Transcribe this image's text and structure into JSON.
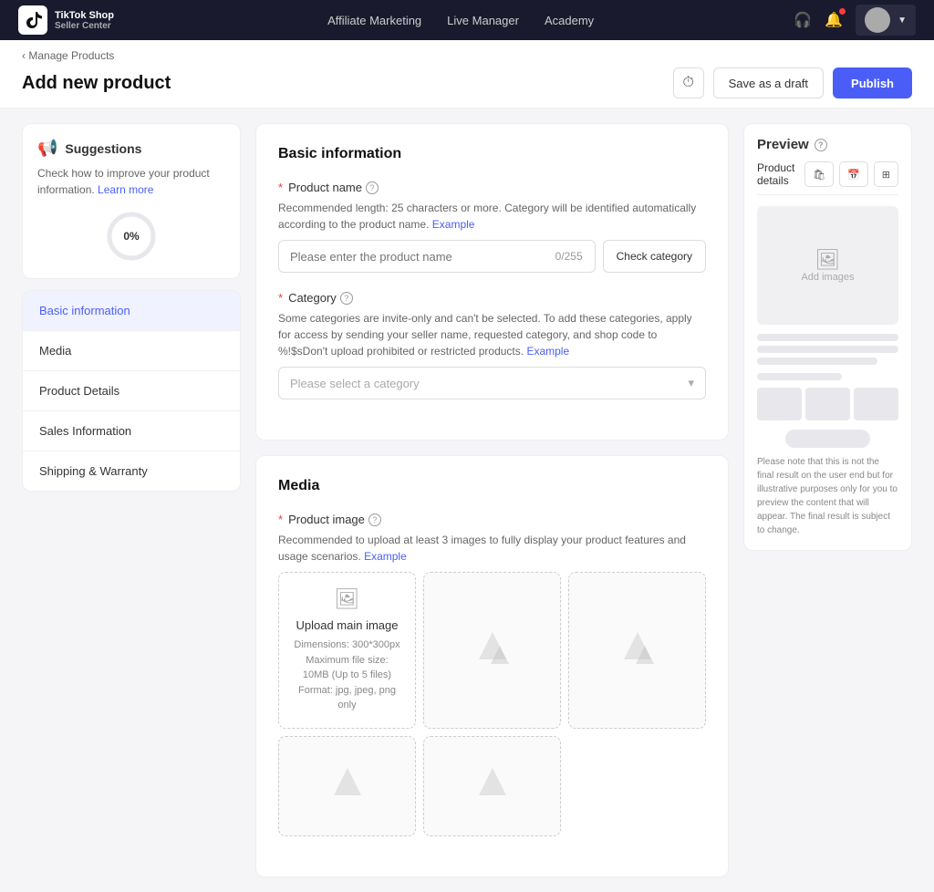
{
  "topnav": {
    "logo_text": "TikTok Shop\nSeller Center",
    "links": [
      "Affiliate Marketing",
      "Live Manager",
      "Academy"
    ],
    "history_icon": "⏱",
    "bell_icon": "🔔",
    "user_placeholder": "User"
  },
  "breadcrumb": {
    "parent": "Manage Products",
    "chevron": "<"
  },
  "page": {
    "title": "Add new product"
  },
  "header_actions": {
    "history_tooltip": "History",
    "save_draft": "Save as a draft",
    "publish": "Publish"
  },
  "suggestions": {
    "title": "Suggestions",
    "icon": "📢",
    "description": "Check how to improve your product information.",
    "learn_more": "Learn more",
    "progress_value": 0,
    "progress_label": "0%"
  },
  "nav": {
    "items": [
      {
        "id": "basic-information",
        "label": "Basic information",
        "active": true
      },
      {
        "id": "media",
        "label": "Media",
        "active": false
      },
      {
        "id": "product-details",
        "label": "Product Details",
        "active": false
      },
      {
        "id": "sales-information",
        "label": "Sales Information",
        "active": false
      },
      {
        "id": "shipping-warranty",
        "label": "Shipping & Warranty",
        "active": false
      }
    ]
  },
  "basic_info": {
    "section_title": "Basic information",
    "product_name": {
      "label": "Product name",
      "hint": "Recommended length: 25 characters or more. Category will be identified automatically according to the product name.",
      "hint_link": "Example",
      "placeholder": "Please enter the product name",
      "char_count": "0/255",
      "check_category_btn": "Check category"
    },
    "category": {
      "label": "Category",
      "hint": "Some categories are invite-only and can't be selected. To add these categories, apply for access by sending your seller name, requested category, and shop code to %!$sDon't upload prohibited or restricted products.",
      "hint_link": "Example",
      "placeholder": "Please select a category"
    }
  },
  "media": {
    "section_title": "Media",
    "product_image": {
      "label": "Product image",
      "hint": "Recommended to upload at least 3 images to fully display your product features and usage scenarios.",
      "hint_link": "Example",
      "upload_main_icon": "🖼",
      "upload_label": "Upload main image",
      "upload_desc_line1": "Dimensions: 300*300px",
      "upload_desc_line2": "Maximum file size: 10MB (Up to 5 files)",
      "upload_desc_line3": "Format: jpg, jpeg, png only"
    }
  },
  "preview": {
    "title": "Preview",
    "product_details_tab": "Product details",
    "tabs": [
      {
        "id": "shop",
        "icon": "🛍",
        "label": ""
      },
      {
        "id": "calendar",
        "icon": "📅",
        "label": ""
      },
      {
        "id": "grid",
        "icon": "⊞",
        "label": ""
      }
    ],
    "add_images_label": "Add images",
    "note": "Please note that this is not the final result on the user end but for illustrative purposes only for you to preview the content that will appear. The final result is subject to change."
  }
}
